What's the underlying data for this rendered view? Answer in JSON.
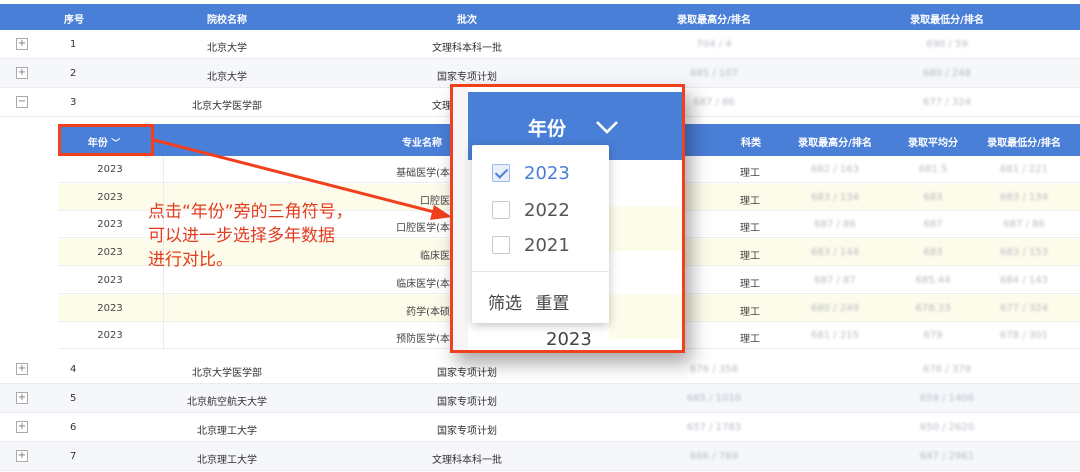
{
  "outer_header": {
    "index": "序号",
    "school": "院校名称",
    "batch": "批次",
    "max": "录取最高分/排名",
    "min": "录取最低分/排名"
  },
  "outer_rows": [
    {
      "index": "1",
      "school": "北京大学",
      "batch": "文理科本科一批",
      "max": "704 / 4",
      "min": "690 / 59",
      "expand": "+"
    },
    {
      "index": "2",
      "school": "北京大学",
      "batch": "国家专项计划",
      "max": "685 / 107",
      "min": "680 / 248",
      "expand": "+"
    },
    {
      "index": "3",
      "school": "北京大学医学部",
      "batch": "文理科本科一批",
      "max": "687 / 86",
      "min": "677 / 324",
      "expand": "−"
    },
    {
      "index": "4",
      "school": "北京大学医学部",
      "batch": "国家专项计划",
      "max": "676 / 358",
      "min": "676 / 379",
      "expand": "+"
    },
    {
      "index": "5",
      "school": "北京航空航天大学",
      "batch": "国家专项计划",
      "max": "665 / 1010",
      "min": "659 / 1406",
      "expand": "+"
    },
    {
      "index": "6",
      "school": "北京理工大学",
      "batch": "国家专项计划",
      "max": "657 / 1783",
      "min": "650 / 2620",
      "expand": "+"
    },
    {
      "index": "7",
      "school": "北京理工大学",
      "batch": "文理科本科一批",
      "max": "666 / 769",
      "min": "647 / 2961",
      "expand": "+"
    }
  ],
  "sub_header": {
    "year": "年份",
    "major": "专业名称",
    "subject": "科类",
    "max": "录取最高分/排名",
    "avg": "录取平均分",
    "min": "录取最低分/排名"
  },
  "sub_rows": [
    {
      "year": "2023",
      "major": "基础医学(本",
      "subject": "理工",
      "max": "682 / 163",
      "avg": "681.5",
      "min": "681 / 221"
    },
    {
      "year": "2023",
      "major": "口腔医",
      "subject": "理工",
      "max": "683 / 134",
      "avg": "683",
      "min": "683 / 134"
    },
    {
      "year": "2023",
      "major": "口腔医学(本",
      "subject": "理工",
      "max": "687 / 86",
      "avg": "687",
      "min": "687 / 86"
    },
    {
      "year": "2023",
      "major": "临床医",
      "subject": "理工",
      "max": "683 / 144",
      "avg": "683",
      "min": "683 / 153"
    },
    {
      "year": "2023",
      "major": "临床医学(本",
      "subject": "理工",
      "max": "687 / 87",
      "avg": "685.44",
      "min": "684 / 143"
    },
    {
      "year": "2023",
      "major": "药学(本硕",
      "subject": "理工",
      "max": "680 / 249",
      "avg": "678.33",
      "min": "677 / 324"
    },
    {
      "year": "2023",
      "major": "预防医学(本",
      "subject": "理工",
      "max": "681 / 215",
      "avg": "679",
      "min": "678 / 301"
    }
  ],
  "annotation": {
    "line1": "点击“年份”旁的三角符号，",
    "line2": "可以进一步选择多年数据",
    "line3": "进行对比。"
  },
  "zoom": {
    "title": "年份",
    "options": [
      {
        "label": "2023",
        "checked": true
      },
      {
        "label": "2022",
        "checked": false
      },
      {
        "label": "2021",
        "checked": false
      }
    ],
    "filter": "筛选",
    "reset": "重置",
    "row_year": "2023"
  },
  "colors": {
    "header_blue": "#4a7fd8",
    "highlight_red": "#f0401d",
    "row_yellow": "#fdfbea"
  }
}
